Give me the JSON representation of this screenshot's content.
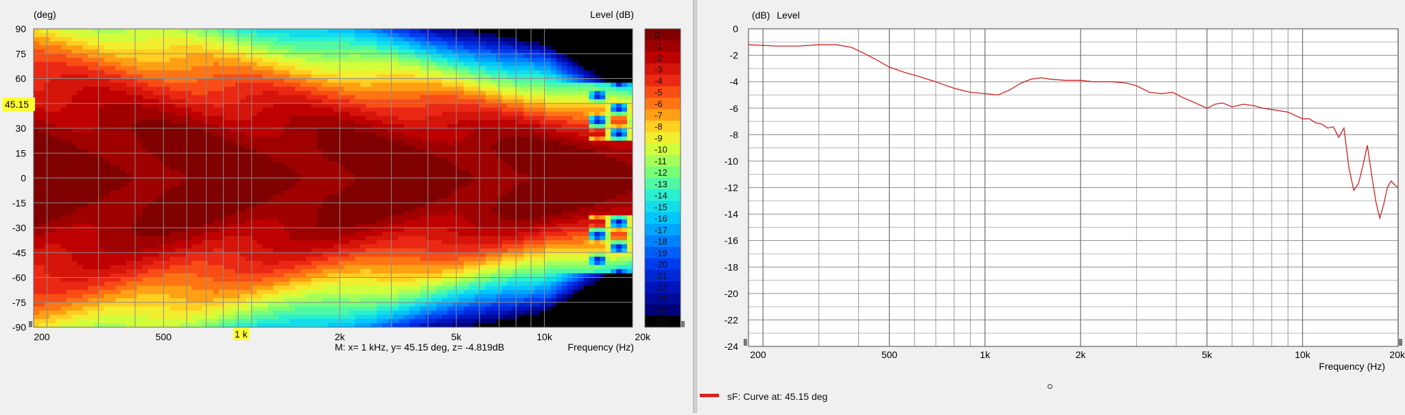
{
  "colors": {
    "grid": "#8c8c8c",
    "curve": "#cc2020",
    "cursor_label_bg": "#ffff33",
    "legend_swatch": "#dd2020"
  },
  "contour": {
    "y_unit_label": "(deg)",
    "z_label": "Level  (dB)",
    "x_label": "Frequency  (Hz)",
    "x_ticks": [
      "200",
      "500",
      "1 k",
      "2k",
      "5k",
      "10k",
      "20k"
    ],
    "y_ticks": [
      "90",
      "75",
      "60",
      "45",
      "30",
      "15",
      "0",
      "-15",
      "-30",
      "-45",
      "-60",
      "-75",
      "-90"
    ],
    "colorbar_ticks": [
      "0",
      "-1",
      "-2",
      "-3",
      "-4",
      "-5",
      "-6",
      "-7",
      "-8",
      "-9",
      "-10",
      "-11",
      "-12",
      "-13",
      "-14",
      "-15",
      "-16",
      "-17",
      "-18",
      "-19",
      "-20",
      "-21",
      "-22",
      "-23",
      "-24",
      "-25"
    ],
    "cursor_y_label": "45.15",
    "cursor_x_label": "1 k",
    "marker_readout": "M:  x= 1 kHz,  y= 45.15 deg, z= -4.819dB"
  },
  "chart_data": [
    {
      "type": "heatmap",
      "title": "",
      "xlabel": "Frequency  (Hz)",
      "ylabel": "(deg)",
      "zlabel": "Level  (dB)",
      "xlim": [
        180,
        20000
      ],
      "ylim": [
        -90,
        90
      ],
      "zlim": [
        -25,
        0
      ],
      "x_scale": "log",
      "x_tick_labels": [
        "200",
        "500",
        "1 k",
        "2k",
        "5k",
        "10k",
        "20k"
      ],
      "y_ticks": [
        90,
        75,
        60,
        45,
        30,
        15,
        0,
        -15,
        -30,
        -45,
        -60,
        -75,
        -90
      ],
      "colorbar": [
        0,
        -1,
        -2,
        -3,
        -4,
        -5,
        -6,
        -7,
        -8,
        -9,
        -10,
        -11,
        -12,
        -13,
        -14,
        -15,
        -16,
        -17,
        -18,
        -19,
        -20,
        -21,
        -22,
        -23,
        -24,
        -25
      ],
      "marker": {
        "x_hz": 1000,
        "y_deg": 45.15,
        "z_db": -4.819
      },
      "grid": true
    },
    {
      "type": "line",
      "title": "",
      "xlabel": "Frequency  (Hz)",
      "ylabel": "Level",
      "y_unit": "(dB)",
      "x_scale": "log",
      "xlim": [
        180,
        20000
      ],
      "ylim": [
        -24,
        0
      ],
      "x_tick_labels": [
        "200",
        "500",
        "1k",
        "2k",
        "5k",
        "10k",
        "20k"
      ],
      "y_ticks": [
        0,
        -2,
        -4,
        -6,
        -8,
        -10,
        -12,
        -14,
        -16,
        -18,
        -20,
        -22,
        -24
      ],
      "grid": true,
      "legend": "bottom-left",
      "series": [
        {
          "name": "sF: Curve at: 45.15 deg",
          "x": [
            180,
            220,
            260,
            300,
            340,
            380,
            420,
            460,
            500,
            560,
            620,
            700,
            800,
            900,
            1000,
            1100,
            1200,
            1300,
            1400,
            1500,
            1600,
            1800,
            2000,
            2200,
            2500,
            2800,
            3000,
            3300,
            3600,
            3900,
            4200,
            4500,
            5000,
            5300,
            5600,
            6000,
            6500,
            7000,
            7500,
            8000,
            9000,
            10000,
            10500,
            11000,
            11500,
            12000,
            12500,
            13000,
            13500,
            14000,
            14500,
            15000,
            15500,
            16000,
            16500,
            17000,
            17500,
            18000,
            18500,
            19000,
            19500,
            20000
          ],
          "values": [
            -1.2,
            -1.3,
            -1.3,
            -1.2,
            -1.2,
            -1.4,
            -1.9,
            -2.4,
            -2.9,
            -3.3,
            -3.6,
            -4.0,
            -4.5,
            -4.8,
            -4.9,
            -5.0,
            -4.6,
            -4.1,
            -3.8,
            -3.7,
            -3.8,
            -3.9,
            -3.9,
            -4.0,
            -4.0,
            -4.1,
            -4.3,
            -4.8,
            -4.9,
            -4.8,
            -5.2,
            -5.5,
            -6.0,
            -5.7,
            -5.6,
            -5.9,
            -5.7,
            -5.8,
            -6.0,
            -6.1,
            -6.3,
            -6.8,
            -6.8,
            -7.1,
            -7.2,
            -7.5,
            -7.4,
            -8.2,
            -7.5,
            -10.5,
            -12.2,
            -11.7,
            -10.3,
            -8.8,
            -11.0,
            -13.0,
            -14.3,
            -13.3,
            -12.0,
            -11.5,
            -11.8,
            -12.0
          ]
        }
      ]
    }
  ]
}
